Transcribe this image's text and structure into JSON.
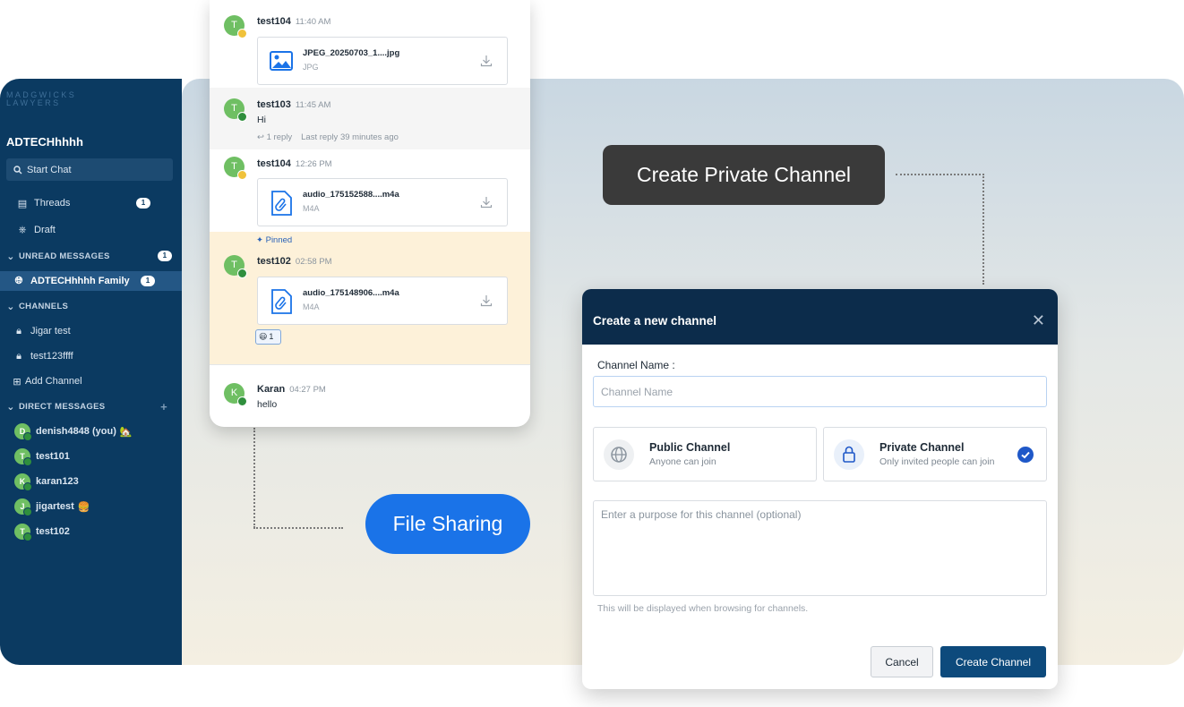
{
  "colors": {
    "sidebar": "#0b3a61",
    "accent_blue": "#1a73e8",
    "dialog_header": "#0c2c4b",
    "primary_button": "#0d4a7c",
    "pinned_bg": "#fdf1d9"
  },
  "sidebar": {
    "brand_line1": "MADGWICKS",
    "brand_line2": "LAWYERS",
    "workspace": "ADTECHhhhh",
    "start_chat": "Start Chat",
    "threads": {
      "label": "Threads",
      "count": "1"
    },
    "draft": "Draft",
    "unread_section": {
      "label": "UNREAD MESSAGES",
      "count": "1"
    },
    "unread_channel": {
      "label": "ADTECHhhhh Family",
      "count": "1"
    },
    "channels_section": "CHANNELS",
    "channels": [
      "Jigar test",
      "test123ffff"
    ],
    "add_channel": "Add Channel",
    "dm_section": "DIRECT MESSAGES",
    "direct_messages": [
      {
        "initial": "D",
        "name": "denish4848 (you)",
        "emoji": "🏡"
      },
      {
        "initial": "T",
        "name": "test101",
        "emoji": ""
      },
      {
        "initial": "K",
        "name": "karan123",
        "emoji": ""
      },
      {
        "initial": "J",
        "name": "jigartest",
        "emoji": "🍔"
      },
      {
        "initial": "T",
        "name": "test102",
        "emoji": ""
      }
    ]
  },
  "chat": {
    "messages": [
      {
        "initial": "T",
        "user": "test104",
        "time": "11:40 AM",
        "file_name": "JPEG_20250703_1....jpg",
        "file_type": "JPG"
      },
      {
        "initial": "T",
        "user": "test103",
        "time": "11:45 AM",
        "text": "Hi",
        "reply_count": "1 reply",
        "last_reply": "Last reply 39 minutes ago"
      },
      {
        "initial": "T",
        "user": "test104",
        "time": "12:26 PM",
        "file_name": "audio_175152588....m4a",
        "file_type": "M4A"
      },
      {
        "pinned_label": "Pinned",
        "initial": "T",
        "user": "test102",
        "time": "02:58 PM",
        "file_name": "audio_175148906....m4a",
        "file_type": "M4A",
        "reaction_emoji": "😃",
        "reaction_count": "1"
      },
      {
        "initial": "K",
        "user": "Karan",
        "time": "04:27 PM",
        "text": "hello"
      }
    ]
  },
  "callouts": {
    "private_channel": "Create Private Channel",
    "file_sharing": "File Sharing"
  },
  "dialog": {
    "title": "Create a new channel",
    "name_label": "Channel Name :",
    "name_placeholder": "Channel Name",
    "public_option": {
      "title": "Public Channel",
      "subtitle": "Anyone can join",
      "icon": "globe-icon"
    },
    "private_option": {
      "title": "Private Channel",
      "subtitle": "Only invited people can join",
      "icon": "lock-icon",
      "selected": true
    },
    "purpose_placeholder": "Enter a purpose for this channel (optional)",
    "purpose_hint": "This will be displayed when browsing for channels.",
    "cancel": "Cancel",
    "create": "Create Channel"
  }
}
